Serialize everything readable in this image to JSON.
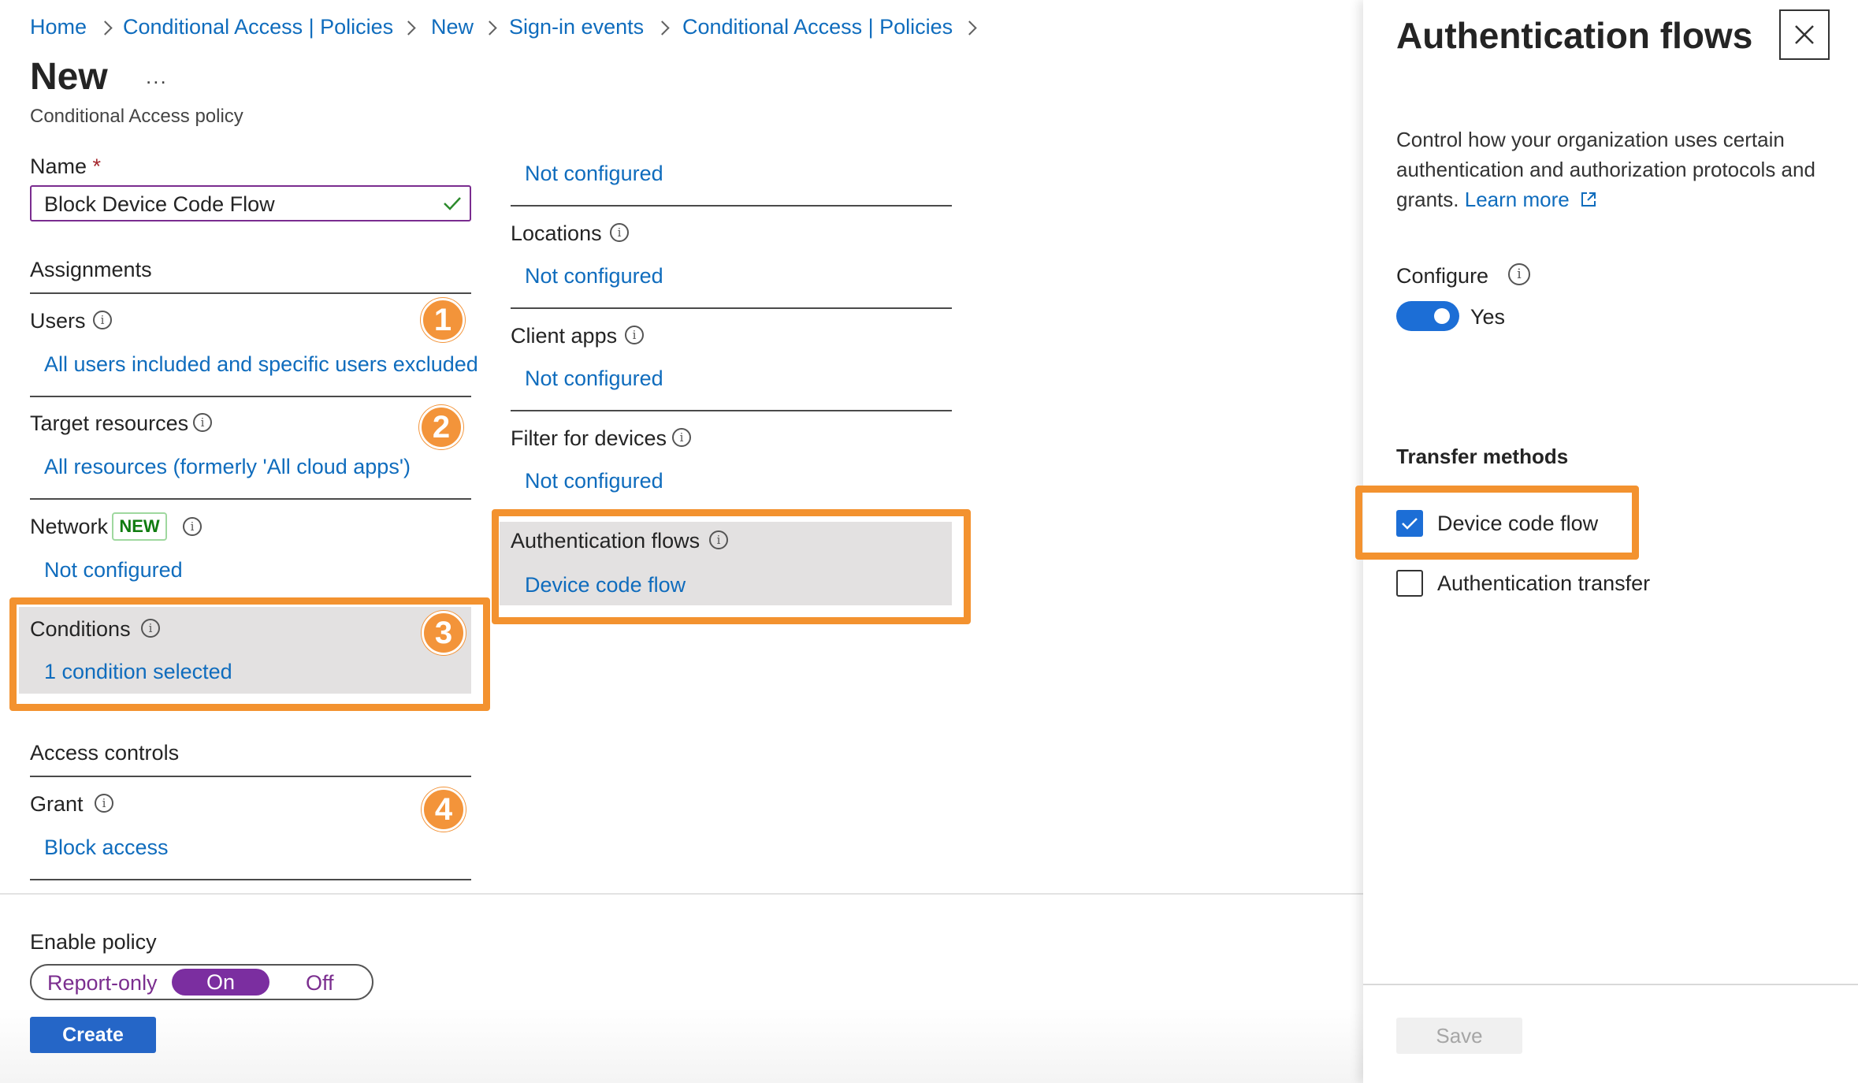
{
  "breadcrumbs": [
    "Home",
    "Conditional Access | Policies",
    "New",
    "Sign-in events",
    "Conditional Access | Policies"
  ],
  "page": {
    "title": "New",
    "more": "...",
    "subtitle": "Conditional Access policy"
  },
  "name_field": {
    "label": "Name",
    "required_mark": "*",
    "value": "Block Device Code Flow"
  },
  "assignments": {
    "heading": "Assignments",
    "users": {
      "label": "Users",
      "value": "All users included and specific users excluded",
      "badge": "1"
    },
    "target_resources": {
      "label": "Target resources",
      "value": "All resources (formerly 'All cloud apps')",
      "badge": "2"
    },
    "network": {
      "label": "Network",
      "tag": "NEW",
      "value": "Not configured"
    },
    "conditions": {
      "label": "Conditions",
      "value": "1 condition selected",
      "badge": "3"
    }
  },
  "access_controls": {
    "heading": "Access controls",
    "grant": {
      "label": "Grant",
      "value": "Block access",
      "badge": "4"
    }
  },
  "conditions_list": {
    "top_value": "Not configured",
    "locations": {
      "label": "Locations",
      "value": "Not configured"
    },
    "client_apps": {
      "label": "Client apps",
      "value": "Not configured"
    },
    "filter_devices": {
      "label": "Filter for devices",
      "value": "Not configured"
    },
    "auth_flows": {
      "label": "Authentication flows",
      "value": "Device code flow"
    }
  },
  "enable_policy": {
    "label": "Enable policy",
    "options": [
      "Report-only",
      "On",
      "Off"
    ],
    "selected": "On"
  },
  "create_button": "Create",
  "panel": {
    "title": "Authentication flows",
    "description": "Control how your organization uses certain authentication and authorization protocols and grants.",
    "learn_more": "Learn more",
    "configure_label": "Configure",
    "toggle_value": "Yes",
    "transfer_heading": "Transfer methods",
    "methods": [
      {
        "label": "Device code flow",
        "checked": true
      },
      {
        "label": "Authentication transfer",
        "checked": false
      }
    ],
    "save_button": "Save"
  },
  "colors": {
    "link": "#0f6cbd",
    "highlight": "#f3922f",
    "toggle_on": "#7b2ea0",
    "toggle_blue": "#1c6ed6",
    "create": "#2566c7",
    "new_badge": "#107c10"
  }
}
